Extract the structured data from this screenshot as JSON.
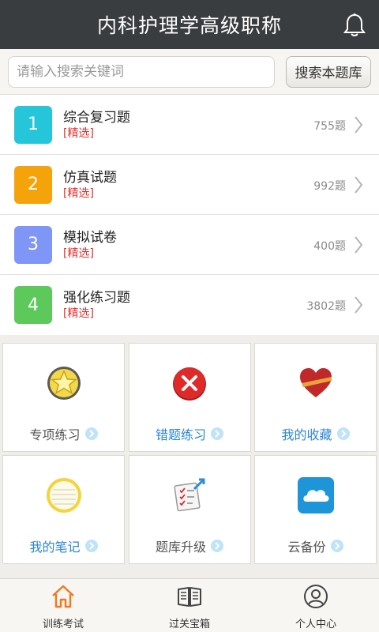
{
  "header": {
    "title": "内科护理学高级职称"
  },
  "search": {
    "placeholder": "请输入搜索关键词",
    "button_label": "搜索本题库"
  },
  "list": {
    "items": [
      {
        "num": "1",
        "title": "综合复习题",
        "tag": "[精选]",
        "count": "755题",
        "color": "#26c6da"
      },
      {
        "num": "2",
        "title": "仿真试题",
        "tag": "[精选]",
        "count": "992题",
        "color": "#f5a30a"
      },
      {
        "num": "3",
        "title": "模拟试卷",
        "tag": "[精选]",
        "count": "400题",
        "color": "#8096f6"
      },
      {
        "num": "4",
        "title": "强化练习题",
        "tag": "[精选]",
        "count": "3802题",
        "color": "#5cc95a"
      }
    ]
  },
  "grid": {
    "tiles": [
      {
        "label": "专项练习",
        "icon": "star-badge-icon",
        "blue": false
      },
      {
        "label": "错题练习",
        "icon": "red-x-icon",
        "blue": true
      },
      {
        "label": "我的收藏",
        "icon": "heart-icon",
        "blue": true
      },
      {
        "label": "我的笔记",
        "icon": "notepad-icon",
        "blue": true
      },
      {
        "label": "题库升级",
        "icon": "checklist-upgrade-icon",
        "blue": false
      },
      {
        "label": "云备份",
        "icon": "cloud-icon",
        "blue": false
      }
    ]
  },
  "tabbar": {
    "tabs": [
      {
        "label": "训练考试",
        "icon": "home-icon",
        "active": true
      },
      {
        "label": "过关宝箱",
        "icon": "book-icon",
        "active": false
      },
      {
        "label": "个人中心",
        "icon": "user-icon",
        "active": false
      }
    ]
  }
}
